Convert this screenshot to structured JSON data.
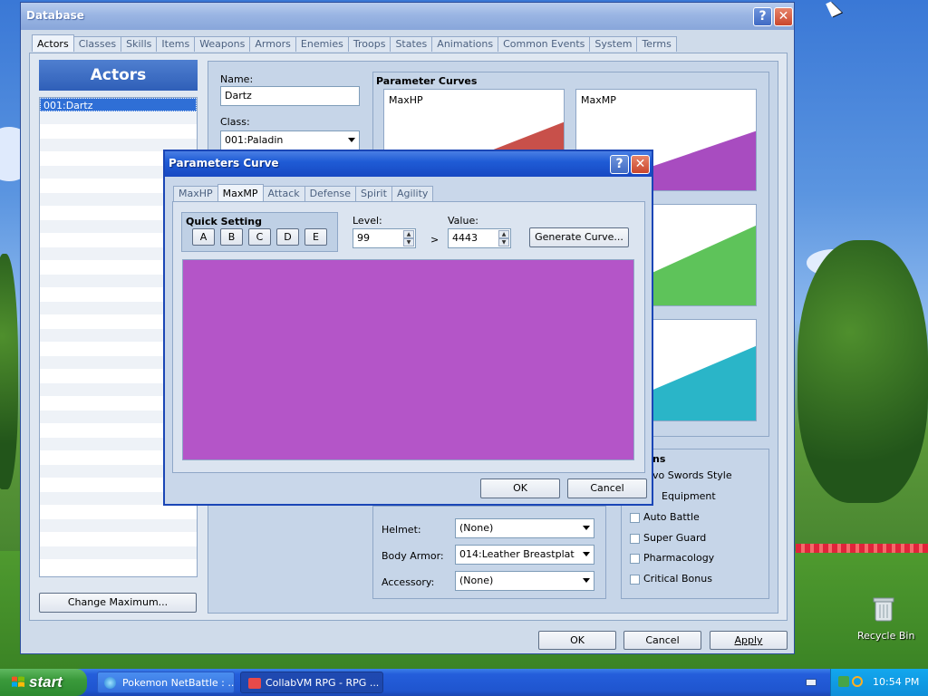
{
  "window": {
    "title": "Database"
  },
  "tabs": [
    "Actors",
    "Classes",
    "Skills",
    "Items",
    "Weapons",
    "Armors",
    "Enemies",
    "Troops",
    "States",
    "Animations",
    "Common Events",
    "System",
    "Terms"
  ],
  "actors_panel": {
    "header": "Actors",
    "items": [
      "001:Dartz"
    ],
    "change_max_label": "Change Maximum..."
  },
  "actor_form": {
    "name_label": "Name:",
    "name_value": "Dartz",
    "class_label": "Class:",
    "class_value": "001:Paladin"
  },
  "parameter_curves": {
    "title": "Parameter Curves",
    "maxhp_label": "MaxHP",
    "maxmp_label": "MaxMP",
    "colors": {
      "hp": "#c8504a",
      "mp": "#a84cc0",
      "str": "#5ec35a",
      "agi": "#2ab5c8"
    }
  },
  "equipment": {
    "helmet_label": "Helmet:",
    "helmet_value": "(None)",
    "body_label": "Body Armor:",
    "body_value": "014:Leather Breastplat",
    "accessory_label": "Accessory:",
    "accessory_value": "(None)"
  },
  "options": {
    "title": "ns",
    "items": [
      "vo Swords Style",
      "Equipment",
      "Auto Battle",
      "Super Guard",
      "Pharmacology",
      "Critical Bonus"
    ]
  },
  "footer": {
    "ok": "OK",
    "cancel": "Cancel",
    "apply": "Apply"
  },
  "dialog": {
    "title": "Parameters Curve",
    "tabs": [
      "MaxHP",
      "MaxMP",
      "Attack",
      "Defense",
      "Spirit",
      "Agility"
    ],
    "quick_setting_label": "Quick Setting",
    "quick_buttons": [
      "A",
      "B",
      "C",
      "D",
      "E"
    ],
    "level_label": "Level:",
    "level_value": "99",
    "arrow": ">",
    "value_label": "Value:",
    "value_value": "4443",
    "generate_label": "Generate Curve...",
    "graph_color": "#b455c8",
    "ok": "OK",
    "cancel": "Cancel"
  },
  "desktop": {
    "recycle_bin": "Recycle Bin"
  },
  "taskbar": {
    "start": "start",
    "tasks": [
      "Pokemon NetBattle : ...",
      "CollabVM RPG - RPG ..."
    ],
    "clock": "10:54 PM"
  }
}
